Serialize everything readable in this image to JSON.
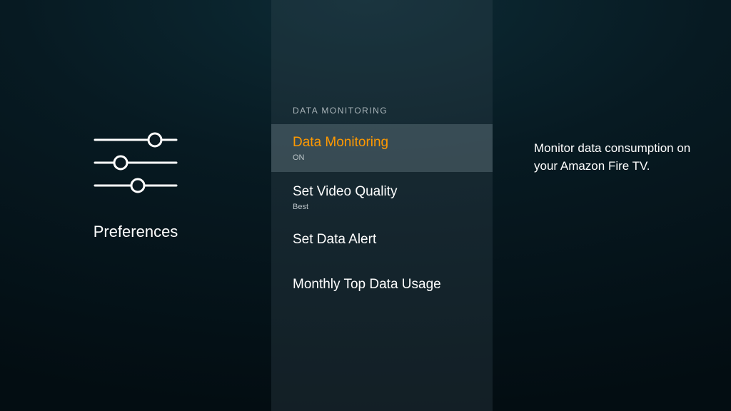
{
  "left": {
    "title": "Preferences"
  },
  "section": {
    "header": "DATA MONITORING"
  },
  "menu": {
    "items": [
      {
        "title": "Data Monitoring",
        "sub": "ON"
      },
      {
        "title": "Set Video Quality",
        "sub": "Best"
      },
      {
        "title": "Set Data Alert",
        "sub": ""
      },
      {
        "title": "Monthly Top Data Usage",
        "sub": ""
      }
    ]
  },
  "detail": {
    "description": "Monitor data consumption on your Amazon Fire TV."
  }
}
